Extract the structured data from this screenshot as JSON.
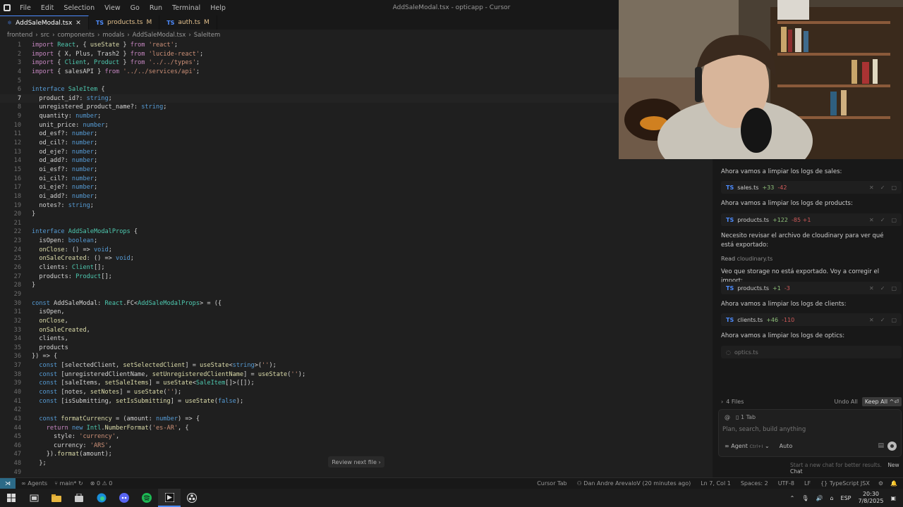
{
  "window": {
    "menu": [
      "File",
      "Edit",
      "Selection",
      "View",
      "Go",
      "Run",
      "Terminal",
      "Help"
    ],
    "title": "AddSaleModal.tsx - opticapp - Cursor"
  },
  "tabs": [
    {
      "label": "AddSaleModal.tsx",
      "kind": "TSX",
      "active": true,
      "modified": ""
    },
    {
      "label": "products.ts",
      "kind": "TS",
      "active": false,
      "modified": "M"
    },
    {
      "label": "auth.ts",
      "kind": "TS",
      "active": false,
      "modified": "M"
    }
  ],
  "breadcrumb": [
    "frontend",
    "src",
    "components",
    "modals",
    "AddSaleModal.tsx",
    "SaleItem"
  ],
  "editor": {
    "current_line": 7,
    "lines": [
      {
        "n": 1,
        "t": "import React, { useState } from 'react';"
      },
      {
        "n": 2,
        "t": "import { X, Plus, Trash2 } from 'lucide-react';"
      },
      {
        "n": 3,
        "t": "import { Client, Product } from '../../types';"
      },
      {
        "n": 4,
        "t": "import { salesAPI } from '../../services/api';"
      },
      {
        "n": 5,
        "t": ""
      },
      {
        "n": 6,
        "t": "interface SaleItem {"
      },
      {
        "n": 7,
        "t": "  product_id?: string;"
      },
      {
        "n": 8,
        "t": "  unregistered_product_name?: string;"
      },
      {
        "n": 9,
        "t": "  quantity: number;"
      },
      {
        "n": 10,
        "t": "  unit_price: number;"
      },
      {
        "n": 11,
        "t": "  od_esf?: number;"
      },
      {
        "n": 12,
        "t": "  od_cil?: number;"
      },
      {
        "n": 13,
        "t": "  od_eje?: number;"
      },
      {
        "n": 14,
        "t": "  od_add?: number;"
      },
      {
        "n": 15,
        "t": "  oi_esf?: number;"
      },
      {
        "n": 16,
        "t": "  oi_cil?: number;"
      },
      {
        "n": 17,
        "t": "  oi_eje?: number;"
      },
      {
        "n": 18,
        "t": "  oi_add?: number;"
      },
      {
        "n": 19,
        "t": "  notes?: string;"
      },
      {
        "n": 20,
        "t": "}"
      },
      {
        "n": 21,
        "t": ""
      },
      {
        "n": 22,
        "t": "interface AddSaleModalProps {"
      },
      {
        "n": 23,
        "t": "  isOpen: boolean;"
      },
      {
        "n": 24,
        "t": "  onClose: () => void;"
      },
      {
        "n": 25,
        "t": "  onSaleCreated: () => void;"
      },
      {
        "n": 26,
        "t": "  clients: Client[];"
      },
      {
        "n": 27,
        "t": "  products: Product[];"
      },
      {
        "n": 28,
        "t": "}"
      },
      {
        "n": 29,
        "t": ""
      },
      {
        "n": 30,
        "t": "const AddSaleModal: React.FC<AddSaleModalProps> = ({"
      },
      {
        "n": 31,
        "t": "  isOpen,"
      },
      {
        "n": 32,
        "t": "  onClose,"
      },
      {
        "n": 33,
        "t": "  onSaleCreated,"
      },
      {
        "n": 34,
        "t": "  clients,"
      },
      {
        "n": 35,
        "t": "  products"
      },
      {
        "n": 36,
        "t": "}) => {"
      },
      {
        "n": 37,
        "t": "  const [selectedClient, setSelectedClient] = useState<string>('');"
      },
      {
        "n": 38,
        "t": "  const [unregisteredClientName, setUnregisteredClientName] = useState('');"
      },
      {
        "n": 39,
        "t": "  const [saleItems, setSaleItems] = useState<SaleItem[]>([]);"
      },
      {
        "n": 40,
        "t": "  const [notes, setNotes] = useState('');"
      },
      {
        "n": 41,
        "t": "  const [isSubmitting, setIsSubmitting] = useState(false);"
      },
      {
        "n": 42,
        "t": ""
      },
      {
        "n": 43,
        "t": "  const formatCurrency = (amount: number) => {"
      },
      {
        "n": 44,
        "t": "    return new Intl.NumberFormat('es-AR', {"
      },
      {
        "n": 45,
        "t": "      style: 'currency',"
      },
      {
        "n": 46,
        "t": "      currency: 'ARS',"
      },
      {
        "n": 47,
        "t": "    }).format(amount);"
      },
      {
        "n": 48,
        "t": "  };"
      },
      {
        "n": 49,
        "t": ""
      }
    ],
    "review_button": "Review next file ›"
  },
  "chat": {
    "messages": [
      "Ahora vamos a limpiar los logs de sales:",
      "Ahora vamos a limpiar los logs de products:",
      "Necesito revisar el archivo de cloudinary para ver qué está exportado:",
      "Veo que storage no está exportado. Voy a corregir el import:",
      "Ahora vamos a limpiar los logs de clients:",
      "Ahora vamos a limpiar los logs de optics:"
    ],
    "read_label": "Read",
    "read_file": "cloudinary.ts",
    "files": [
      {
        "name": "sales.ts",
        "add": "+33",
        "del": "-42"
      },
      {
        "name": "products.ts",
        "add": "+122",
        "del": "-85 +1"
      },
      {
        "name": "products.ts",
        "add": "+1",
        "del": "-3"
      },
      {
        "name": "clients.ts",
        "add": "+46",
        "del": "-110"
      }
    ],
    "pending_file": "optics.ts",
    "files_count": "4 Files",
    "undo_all": "Undo All",
    "keep_all": "Keep All ^⏎",
    "context_tab": "1 Tab",
    "input_placeholder": "Plan, search, build anything",
    "mode": "Agent",
    "mode_shortcut": "Ctrl+I",
    "model": "Auto",
    "footer_hint": "Start a new chat for better results.",
    "new_chat": "New Chat"
  },
  "status": {
    "agents": "Agents",
    "branch": "main*",
    "problems": "0",
    "warnings": "0",
    "cursor_tab": "Cursor Tab",
    "blame": "Dan Andre ArevaloV (20 minutes ago)",
    "position": "Ln 7, Col 1",
    "spaces": "Spaces: 2",
    "encoding": "UTF-8",
    "eol": "LF",
    "language": "TypeScript JSX"
  },
  "taskbar": {
    "lang": "ESP",
    "time": "20:30",
    "date": "7/8/2025"
  },
  "colors": {
    "accent": "#4d8cff",
    "keyword": "#569cd6",
    "control": "#c586c0",
    "string": "#ce9178",
    "type": "#4ec9b0",
    "property": "#9cdcfe",
    "function": "#dcdcaa",
    "added": "#8fc07a",
    "removed": "#d05a5a"
  }
}
